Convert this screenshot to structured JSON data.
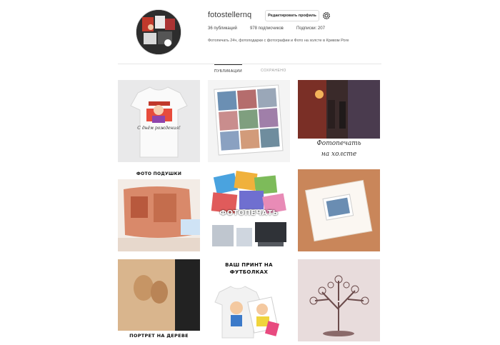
{
  "profile": {
    "username": "fotostellernq",
    "edit_button_label": "Редактировать профиль",
    "stats": {
      "posts": "36 публикаций",
      "followers": "978 подписчиков",
      "following": "Подписки: 207"
    },
    "bio": "Фотопечать 24ч, фотоподарки с фотографии и Фото на холсте в Кривом Роге"
  },
  "tabs": [
    {
      "label": "ПУБЛИКАЦИИ",
      "active": true
    },
    {
      "label": "СОХРАНЕНО",
      "active": false
    }
  ],
  "posts": [
    {
      "caption": "С днём рождения!"
    },
    {
      "caption": ""
    },
    {
      "caption_line1": "Фотопечать",
      "caption_line2": "на холсте"
    },
    {
      "caption": "ФОТО ПОДУШКИ"
    },
    {
      "caption": "ФОТОПЕЧАТЬ"
    },
    {
      "caption": ""
    },
    {
      "caption": "ПОРТРЕТ НА ДЕРЕВЕ"
    },
    {
      "caption_line1": "ВАШ ПРИНТ НА",
      "caption_line2": "ФУТБОЛКАХ"
    },
    {
      "caption": ""
    }
  ],
  "icons": {
    "settings": "gear-icon",
    "avatar": "avatar"
  },
  "colors": {
    "border": "#dbdbdb",
    "text": "#262626"
  }
}
